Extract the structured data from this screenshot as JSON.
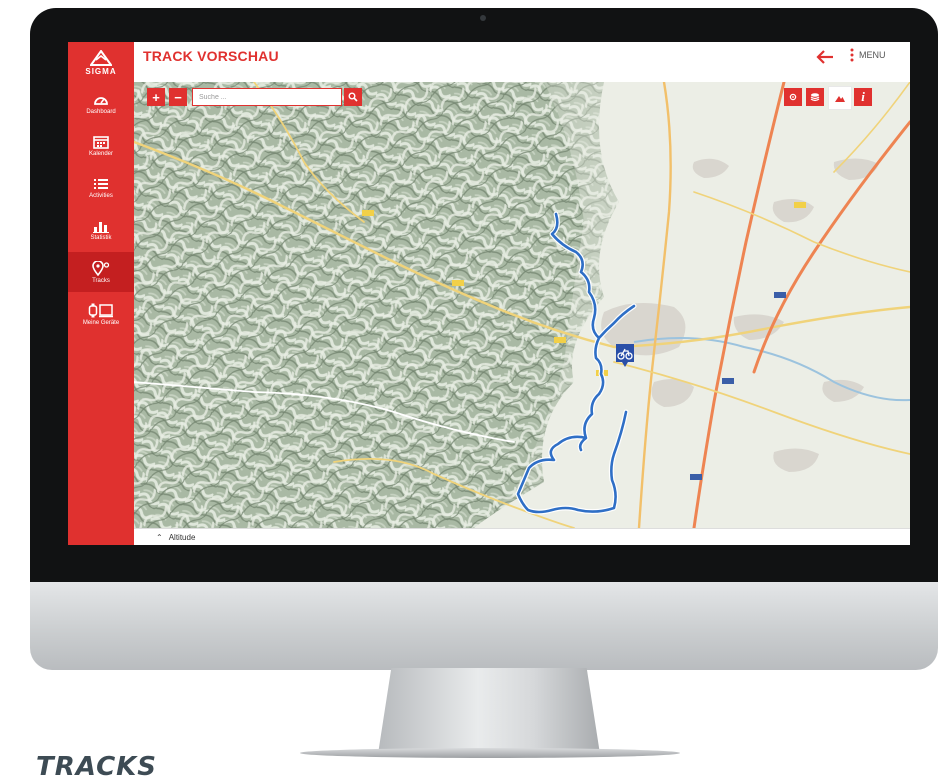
{
  "app": {
    "brand": "SIGMA",
    "accent_color": "#e0312f",
    "active_color": "#c41f20"
  },
  "sidebar": {
    "items": [
      {
        "label": "Dashboard",
        "icon": "speedometer-icon",
        "active": false
      },
      {
        "label": "Kalender",
        "icon": "calendar-icon",
        "active": false
      },
      {
        "label": "Activities",
        "icon": "list-icon",
        "active": false
      },
      {
        "label": "Statistik",
        "icon": "bar-chart-icon",
        "active": false
      },
      {
        "label": "Tracks",
        "icon": "track-pin-icon",
        "active": true
      },
      {
        "label": "Meine Geräte",
        "icon": "devices-icon",
        "active": false
      }
    ]
  },
  "header": {
    "title": "TRACK VORSCHAU",
    "back_icon": "arrow-left-icon",
    "menu_icon": "vertical-dots-icon",
    "menu_label": "MENU"
  },
  "map_controls": {
    "zoom_in_label": "+",
    "zoom_out_label": "−",
    "search_placeholder": "Suche ...",
    "search_icon": "search-icon",
    "layer_buttons": [
      "locate-icon",
      "layers-icon",
      "terrain-icon",
      "info-icon"
    ],
    "active_layer": "terrain-icon"
  },
  "track": {
    "color": "#2f6fc6",
    "start_marker_icon": "bike-icon"
  },
  "bottom_panel": {
    "label": "Altitude",
    "toggle_icon": "chevron-up-icon"
  },
  "caption": "TRACKS"
}
